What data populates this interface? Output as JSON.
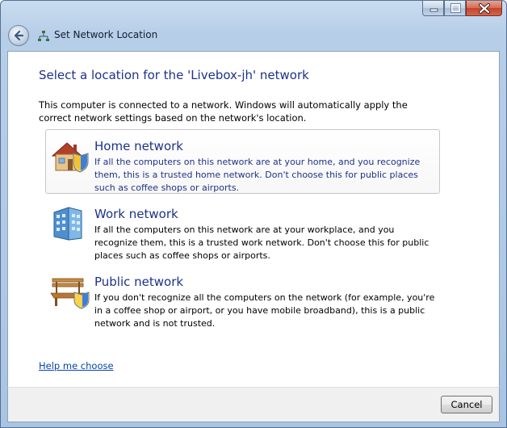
{
  "window": {
    "title": "Set Network Location"
  },
  "main": {
    "heading": "Select a location for the 'Livebox-jh' network",
    "intro": "This computer is connected to a network. Windows will automatically apply the correct network settings based on the network's location.",
    "options": [
      {
        "title": "Home network",
        "description": "If all the computers on this network are at your home, and you recognize them, this is a trusted home network.  Don't choose this for public places such as coffee shops or airports.",
        "icon": "home-network-icon",
        "selected": true
      },
      {
        "title": "Work network",
        "description": "If all the computers on this network are at your workplace, and you recognize them, this is a trusted work network.  Don't choose this for public places such as coffee shops or airports.",
        "icon": "work-network-icon",
        "selected": false
      },
      {
        "title": "Public network",
        "description": "If you don't recognize all the computers on the network (for example, you're in a coffee shop or airport, or you have mobile broadband), this is a public network and is not trusted.",
        "icon": "public-network-icon",
        "selected": false
      }
    ],
    "help_link": "Help me choose"
  },
  "footer": {
    "cancel_label": "Cancel"
  },
  "colors": {
    "heading": "#1e3287",
    "link": "#0645ad",
    "close_button": "#c3432a"
  }
}
